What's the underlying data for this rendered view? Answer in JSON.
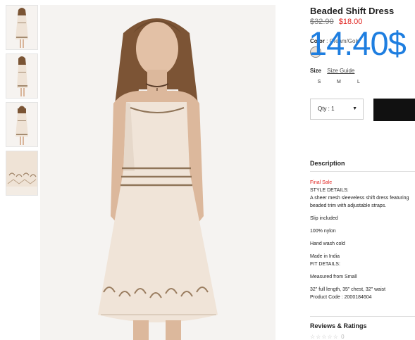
{
  "product": {
    "title": "Beaded Shift Dress",
    "price_old": "$32.90",
    "price_new": "$18.00",
    "color_label": "Color",
    "color_value": "Cream/Gold",
    "size_label": "Size",
    "size_guide": "Size Guide",
    "sizes": [
      "S",
      "M",
      "L"
    ],
    "qty_label": "Qty : 1",
    "swatch_color": "#ece2d8"
  },
  "overlay_price": "14.40$",
  "description": {
    "heading": "Description",
    "final_sale": "Final Sale",
    "style_heading": "STYLE DETAILS:",
    "style_text": "A sheer mesh sleeveless shift dress featuring beaded trim with adjustable straps.",
    "slip": "Slip included",
    "fabric": "100% nylon",
    "care": "Hand wash cold",
    "origin": "Made in India",
    "fit_heading": "FIT DETAILS:",
    "fit_size": "Measured from Small",
    "fit_measure": "32\" full length, 35\" chest, 32\" waist",
    "product_code": "Product Code : 2000184604"
  },
  "reviews": {
    "heading": "Reviews & Ratings",
    "stars": "☆☆☆☆☆",
    "count": "0"
  },
  "colors": {
    "price_sale": "#e0231f",
    "overlay": "#1e7ee0",
    "button": "#111111"
  }
}
